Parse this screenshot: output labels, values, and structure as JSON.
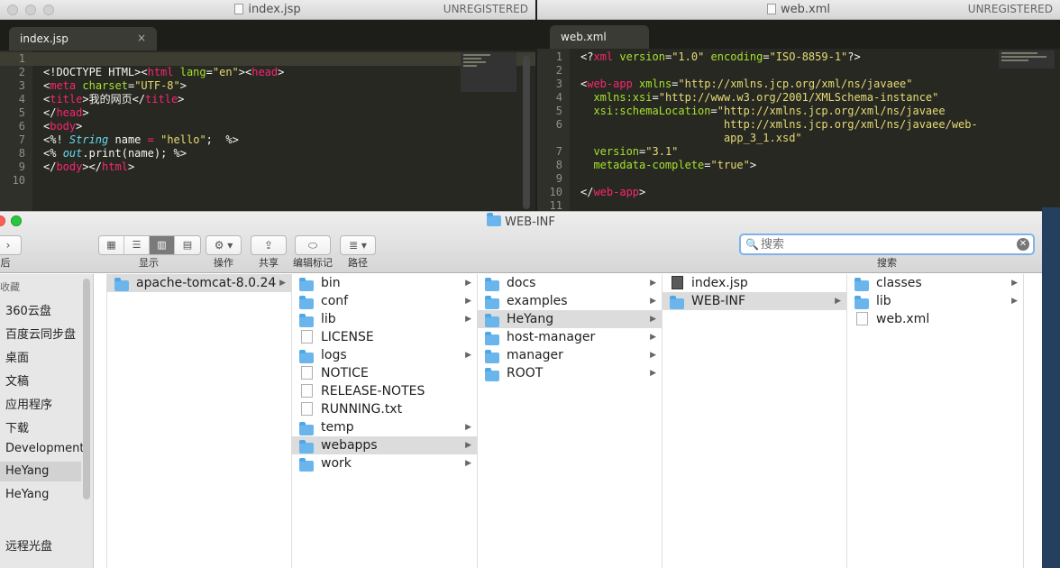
{
  "editor_left": {
    "title": "index.jsp",
    "unregistered": "UNREGISTERED",
    "tab": "index.jsp",
    "tab_close": "×",
    "lines": [
      "1",
      "2",
      "3",
      "4",
      "5",
      "6",
      "7",
      "8",
      "9",
      "10"
    ]
  },
  "editor_right": {
    "title": "web.xml",
    "unregistered": "UNREGISTERED",
    "tab": "web.xml",
    "lines": [
      "1",
      "2",
      "3",
      "4",
      "5",
      "6",
      "",
      "7",
      "8",
      "9",
      "10",
      "11"
    ]
  },
  "finder": {
    "title": "WEB-INF",
    "toolbar": {
      "back_label": "后",
      "view_label": "显示",
      "action_label": "操作",
      "share_label": "共享",
      "tags_label": "编辑标记",
      "path_label": "路径",
      "search_label": "搜索",
      "search_placeholder": "搜索"
    },
    "sidebar": {
      "header": "收藏",
      "items": [
        "360云盘",
        "百度云同步盘",
        "桌面",
        "文稿",
        "应用程序",
        "下载",
        "Development",
        "HeYang",
        "HeYang",
        "远程光盘"
      ]
    },
    "columns": [
      [
        {
          "name": "apache-tomcat-8.0.24",
          "type": "folder",
          "selected": true,
          "arrow": true
        }
      ],
      [
        {
          "name": "bin",
          "type": "folder",
          "arrow": true
        },
        {
          "name": "conf",
          "type": "folder",
          "arrow": true
        },
        {
          "name": "lib",
          "type": "folder",
          "arrow": true
        },
        {
          "name": "LICENSE",
          "type": "file"
        },
        {
          "name": "logs",
          "type": "folder",
          "arrow": true
        },
        {
          "name": "NOTICE",
          "type": "file"
        },
        {
          "name": "RELEASE-NOTES",
          "type": "file"
        },
        {
          "name": "RUNNING.txt",
          "type": "file"
        },
        {
          "name": "temp",
          "type": "folder",
          "arrow": true
        },
        {
          "name": "webapps",
          "type": "folder",
          "selected": true,
          "arrow": true
        },
        {
          "name": "work",
          "type": "folder",
          "arrow": true
        }
      ],
      [
        {
          "name": "docs",
          "type": "folder",
          "arrow": true
        },
        {
          "name": "examples",
          "type": "folder",
          "arrow": true
        },
        {
          "name": "HeYang",
          "type": "folder",
          "selected": true,
          "arrow": true
        },
        {
          "name": "host-manager",
          "type": "folder",
          "arrow": true
        },
        {
          "name": "manager",
          "type": "folder",
          "arrow": true
        },
        {
          "name": "ROOT",
          "type": "folder",
          "arrow": true
        }
      ],
      [
        {
          "name": "index.jsp",
          "type": "jsp"
        },
        {
          "name": "WEB-INF",
          "type": "folder",
          "selected": true,
          "arrow": true
        }
      ],
      [
        {
          "name": "classes",
          "type": "folder",
          "arrow": true
        },
        {
          "name": "lib",
          "type": "folder",
          "arrow": true
        },
        {
          "name": "web.xml",
          "type": "file"
        }
      ]
    ]
  },
  "colors": {
    "editor_bg": "#272822",
    "tag": "#f92672",
    "attr": "#a6e22e",
    "string": "#e6db74",
    "keyword": "#66d9ef",
    "finder_selection": "#dcdcdc",
    "folder": "#6ab6ec"
  }
}
